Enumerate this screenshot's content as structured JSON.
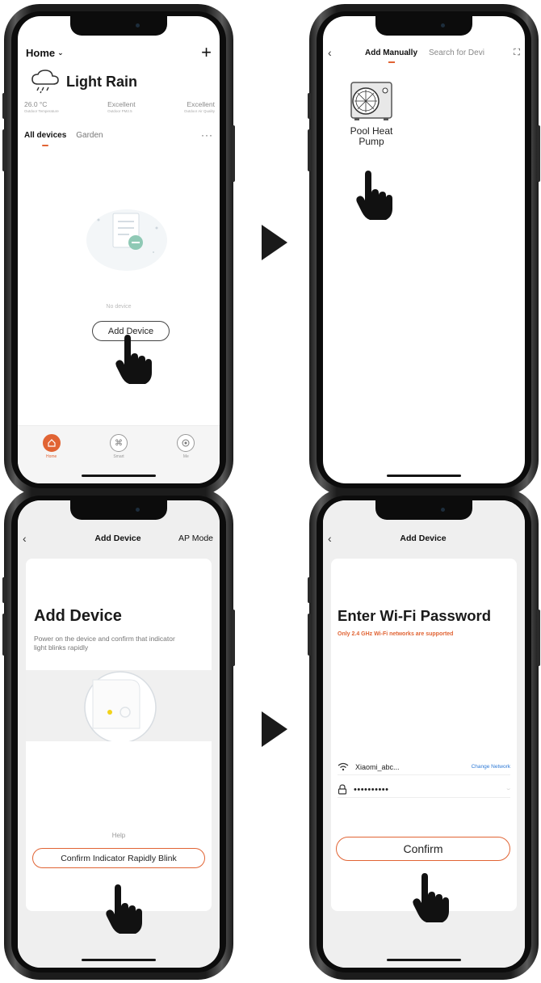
{
  "screen1": {
    "home_label": "Home",
    "weather": "Light Rain",
    "stats": [
      {
        "value": "26.0 °C",
        "caption": "Outdoor Temperature"
      },
      {
        "value": "Excellent",
        "caption": "Outdoor PM2.5"
      },
      {
        "value": "Excellent",
        "caption": "Outdoor Air Quality"
      }
    ],
    "tabs": [
      "All devices",
      "Garden"
    ],
    "more": "···",
    "empty_text": "No device",
    "add_device": "Add Device",
    "nav": [
      "Home",
      "Smart",
      "Me"
    ]
  },
  "screen2": {
    "tab_manual": "Add Manually",
    "tab_search": "Search for Devi",
    "device_label_1": "Pool Heat",
    "device_label_2": "Pump"
  },
  "screen3": {
    "title": "Add Device",
    "ap_mode": "AP Mode",
    "heading": "Add Device",
    "description": "Power on the device and confirm that indicator light blinks rapidly",
    "help": "Help",
    "confirm": "Confirm Indicator Rapidly Blink"
  },
  "screen4": {
    "title": "Add Device",
    "heading": "Enter Wi-Fi Password",
    "note": "Only 2.4 GHz Wi-Fi networks are supported",
    "ssid": "Xiaomi_abc...",
    "change_network": "Change Network",
    "password": "••••••••••",
    "confirm": "Confirm"
  },
  "colors": {
    "accent": "#e16434",
    "link": "#2f7ad6",
    "frame": "#1c1c1c"
  }
}
